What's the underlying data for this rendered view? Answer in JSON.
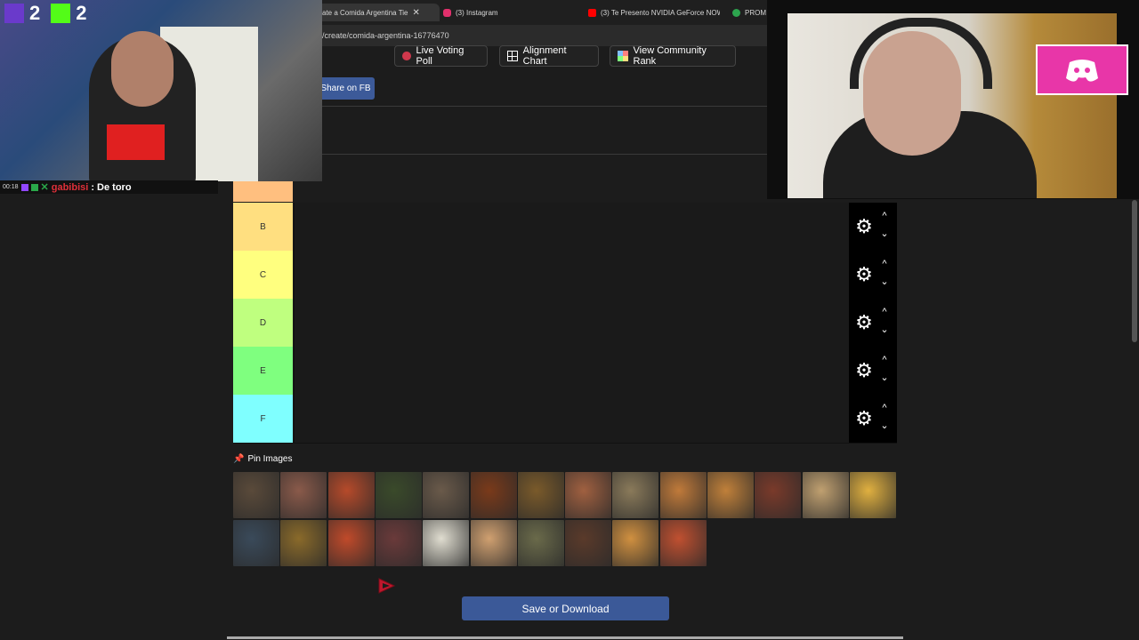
{
  "browser": {
    "tabs": [
      {
        "label": "ate a Comida Argentina Tie",
        "active": true
      },
      {
        "label": "(3) Instagram"
      },
      {
        "label": "(3) Te Presento NVIDIA GeForce NOW"
      },
      {
        "label": "PROM"
      }
    ],
    "url": "/create/comida-argentina-16776470",
    "window_controls": [
      "—",
      "☐",
      "✕"
    ]
  },
  "toolbar": {
    "live_voting_poll": "Live Voting Poll",
    "alignment_chart": "Alignment Chart",
    "view_community_rank": "View Community Rank",
    "share_fb": "Share on FB"
  },
  "tiers": [
    {
      "label": "B",
      "color": "#ffdf80"
    },
    {
      "label": "C",
      "color": "#ffff7f"
    },
    {
      "label": "D",
      "color": "#bfff7f"
    },
    {
      "label": "E",
      "color": "#7fff7f"
    },
    {
      "label": "F",
      "color": "#7fffff"
    }
  ],
  "pin_images": {
    "label": "Pin Images"
  },
  "images": [
    {
      "alt": "asado",
      "color": "#5a4a3a"
    },
    {
      "alt": "provoleta",
      "color": "#8a5a4a"
    },
    {
      "alt": "choripan",
      "color": "#b64a2a"
    },
    {
      "alt": "huevos",
      "color": "#3a4a2a"
    },
    {
      "alt": "cordero",
      "color": "#6a5a4a"
    },
    {
      "alt": "locro",
      "color": "#7a3a1a"
    },
    {
      "alt": "guiso",
      "color": "#7a5a2a"
    },
    {
      "alt": "fugazzeta",
      "color": "#a06040"
    },
    {
      "alt": "milanesa",
      "color": "#8a7a5a"
    },
    {
      "alt": "milanesa napolitana",
      "color": "#c07a3a"
    },
    {
      "alt": "mondongo",
      "color": "#c0803a"
    },
    {
      "alt": "matambre",
      "color": "#7a3a2a"
    },
    {
      "alt": "noquis",
      "color": "#c0a070"
    },
    {
      "alt": "polenta",
      "color": "#e0b040"
    },
    {
      "alt": "sopa",
      "color": "#3a4a5a"
    },
    {
      "alt": "puchero",
      "color": "#8a6a2a"
    },
    {
      "alt": "pizza",
      "color": "#c04a2a"
    },
    {
      "alt": "morcilla",
      "color": "#6a3a3a"
    },
    {
      "alt": "sandwich de miga",
      "color": "#e0ddd0"
    },
    {
      "alt": "ravioles",
      "color": "#d0a070"
    },
    {
      "alt": "fideos",
      "color": "#6a6a4a"
    },
    {
      "alt": "carne",
      "color": "#5a3a2a"
    },
    {
      "alt": "empanadas",
      "color": "#d09040"
    },
    {
      "alt": "pizza muzzarella",
      "color": "#c05030"
    }
  ],
  "save_button": "Save or Download",
  "overlay": {
    "counter_left": "2",
    "counter_kick": "2",
    "chat_time": "00:18",
    "chat_user": "gabibisi",
    "chat_message": ": De toro"
  }
}
